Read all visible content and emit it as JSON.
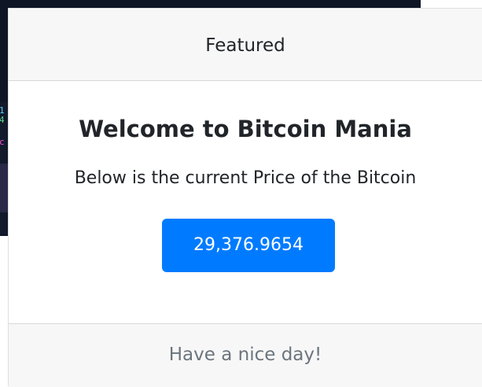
{
  "background_window": {
    "gutter_lines": [
      "1",
      "4",
      "c"
    ],
    "colors": {
      "background": "#0e1626",
      "line_1": "#5fd3ff",
      "line_2": "#59d68b",
      "line_3": "#ff4ad8",
      "band": "#2a2948"
    }
  },
  "card": {
    "header": "Featured",
    "title": "Welcome to Bitcoin Mania",
    "text": "Below is the current Price of the Bitcoin",
    "price_button": "29,376.9654",
    "footer": "Have a nice day!",
    "colors": {
      "primary_button": "#007bff",
      "header_footer_bg": "#f7f7f7",
      "footer_text": "#6c757d"
    }
  }
}
